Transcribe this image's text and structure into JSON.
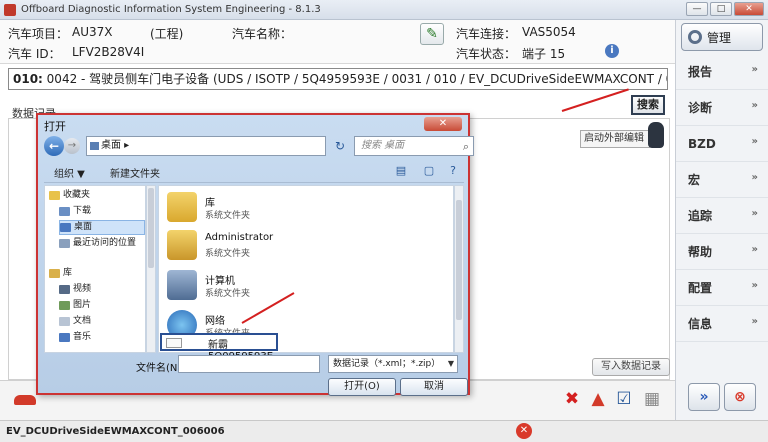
{
  "window": {
    "title": "Offboard Diagnostic Information System Engineering - 8.1.3",
    "btn_min": "—",
    "btn_max": "□",
    "btn_close": "✕"
  },
  "vehicle": {
    "project_label": "汽车项目：",
    "project_value": "AU37X",
    "project_note": "(工程)",
    "name_label": "汽车名称：",
    "id_label": "汽车 ID：",
    "id_value": "LFV2B28V4I",
    "connection_label": "汽车连接：",
    "connection_value": "VAS5054",
    "status_label": "汽车状态：",
    "status_value": "端子 15"
  },
  "path": {
    "code": "010:",
    "text": " 0042 - 驾驶员侧车门电子设备  (UDS / ISOTP / 5Q4959593E / 0031 / 010 / EV_DCUDriveSideEWMAXCONT / 006001)"
  },
  "data_record_label": "数据记录",
  "search_button": "搜索",
  "tooltip": "启动外部编辑",
  "write_button": "写入数据记录",
  "sidebar": {
    "manage": "管理",
    "items": [
      {
        "label": "报告"
      },
      {
        "label": "诊断"
      },
      {
        "label": "BZD"
      },
      {
        "label": "宏"
      },
      {
        "label": "追踪"
      },
      {
        "label": "帮助"
      },
      {
        "label": "配置"
      },
      {
        "label": "信息"
      }
    ],
    "chevron": "»"
  },
  "status_bar": {
    "text": "EV_DCUDriveSideEWMAXCONT_006006"
  },
  "dialog": {
    "title": "打开",
    "address": "桌面  ▸",
    "search_placeholder": "搜索 桌面",
    "organize": "组织 ▼",
    "new_folder": "新建文件夹",
    "tree": [
      {
        "label": "收藏夹"
      },
      {
        "label": "下载"
      },
      {
        "label": "桌面"
      },
      {
        "label": "最近访问的位置"
      },
      {
        "label": "库"
      },
      {
        "label": "视频"
      },
      {
        "label": "图片"
      },
      {
        "label": "文档"
      },
      {
        "label": "音乐"
      }
    ],
    "files": [
      {
        "name": "库",
        "sub": "系统文件夹"
      },
      {
        "name": "Administrator",
        "sub": "系统文件夹"
      },
      {
        "name": "计算机",
        "sub": "系统文件夹"
      },
      {
        "name": "网络",
        "sub": "系统文件夹"
      }
    ],
    "selected_file": "新霸5Q0959593E",
    "filename_label": "文件名(N):",
    "filetype": "数据记录（*.xml；*.zip）",
    "open_button": "打开(O)",
    "cancel_button": "取消"
  },
  "colors": {
    "accent": "#d42020",
    "sidebar_bg": "#f1f3f6",
    "dialog_bg": "#c9dcf1"
  }
}
